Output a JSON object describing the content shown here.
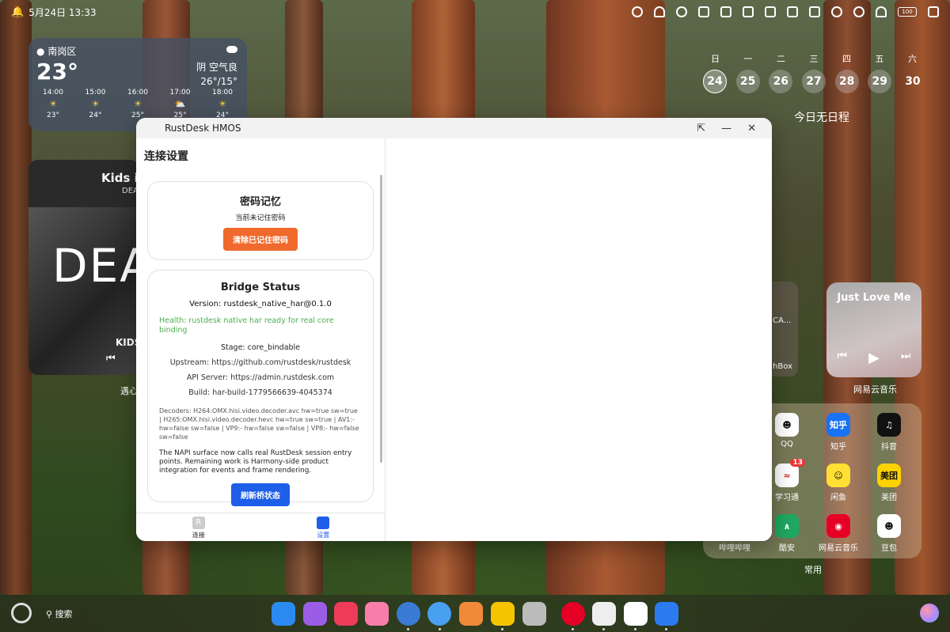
{
  "status_bar": {
    "date_time": "5月24日 13:33",
    "battery": "100"
  },
  "weather": {
    "location": "南岗区",
    "temperature": "23°",
    "condition": "阴 空气良",
    "range": "26°/15°",
    "hours": [
      {
        "time": "14:00",
        "temp": "23°"
      },
      {
        "time": "15:00",
        "temp": "24°"
      },
      {
        "time": "16:00",
        "temp": "25°"
      },
      {
        "time": "17:00",
        "temp": "25°"
      },
      {
        "time": "18:00",
        "temp": "24°"
      }
    ]
  },
  "music_left": {
    "title": "Kids i",
    "subtitle": "DEA",
    "art_text": "DEA",
    "art_label": "KIDS",
    "under_label": "遇心"
  },
  "calendar": {
    "weekdays": [
      "日",
      "一",
      "二",
      "三",
      "四",
      "五",
      "六"
    ],
    "dates": [
      "24",
      "25",
      "26",
      "27",
      "28",
      "29",
      "30"
    ],
    "no_events": "今日无日程"
  },
  "music_right": {
    "title": "Just Love Me",
    "app_label": "网易云音乐"
  },
  "partial_widget": {
    "label1": "CA...",
    "label2": "hBox"
  },
  "folder": {
    "label": "常用",
    "hidden_label": "哔哩哔哩",
    "apps": [
      {
        "name": "QQ",
        "color": "#ffffff"
      },
      {
        "name": "知乎",
        "color": "#1772f6"
      },
      {
        "name": "抖音",
        "color": "#111111"
      },
      {
        "name": "学习通",
        "color": "#ffffff",
        "badge": "13"
      },
      {
        "name": "闲鱼",
        "color": "#ffe033"
      },
      {
        "name": "美团",
        "color": "#ffd100"
      },
      {
        "name": "酷安",
        "color": "#1ea861"
      },
      {
        "name": "网易云音乐",
        "color": "#e60026"
      },
      {
        "name": "豆包",
        "color": "#ffffff"
      }
    ]
  },
  "window": {
    "title": "RustDesk HMOS",
    "left_title": "连接设置",
    "password_card": {
      "title": "密码记忆",
      "subtitle": "当前未记住密码",
      "button": "清除已记住密码"
    },
    "bridge_card": {
      "title": "Bridge Status",
      "version": "Version: rustdesk_native_har@0.1.0",
      "health": "Health: rustdesk native har ready for real core binding",
      "stage": "Stage: core_bindable",
      "upstream": "Upstream: https://github.com/rustdesk/rustdesk",
      "api_server": "API Server: https://admin.rustdesk.com",
      "build": "Build: har-build-1779566639-4045374",
      "decoders": "Decoders: H264:OMX.hisi.video.decoder.avc hw=true sw=true | H265:OMX.hisi.video.decoder.hevc hw=true sw=true | AV1:- hw=false sw=false | VP9:- hw=false sw=false | VP8:- hw=false sw=false",
      "note": "The NAPI surface now calls real RustDesk session entry points. Remaining work is Harmony-side product integration for events and frame rendering.",
      "button": "刷新桥状态"
    },
    "tabs": [
      {
        "label": "连接"
      },
      {
        "label": "设置"
      }
    ],
    "accent_orange": "#ef6a2c",
    "accent_blue": "#1f5ee8"
  },
  "dock": {
    "search_label": "搜索"
  }
}
